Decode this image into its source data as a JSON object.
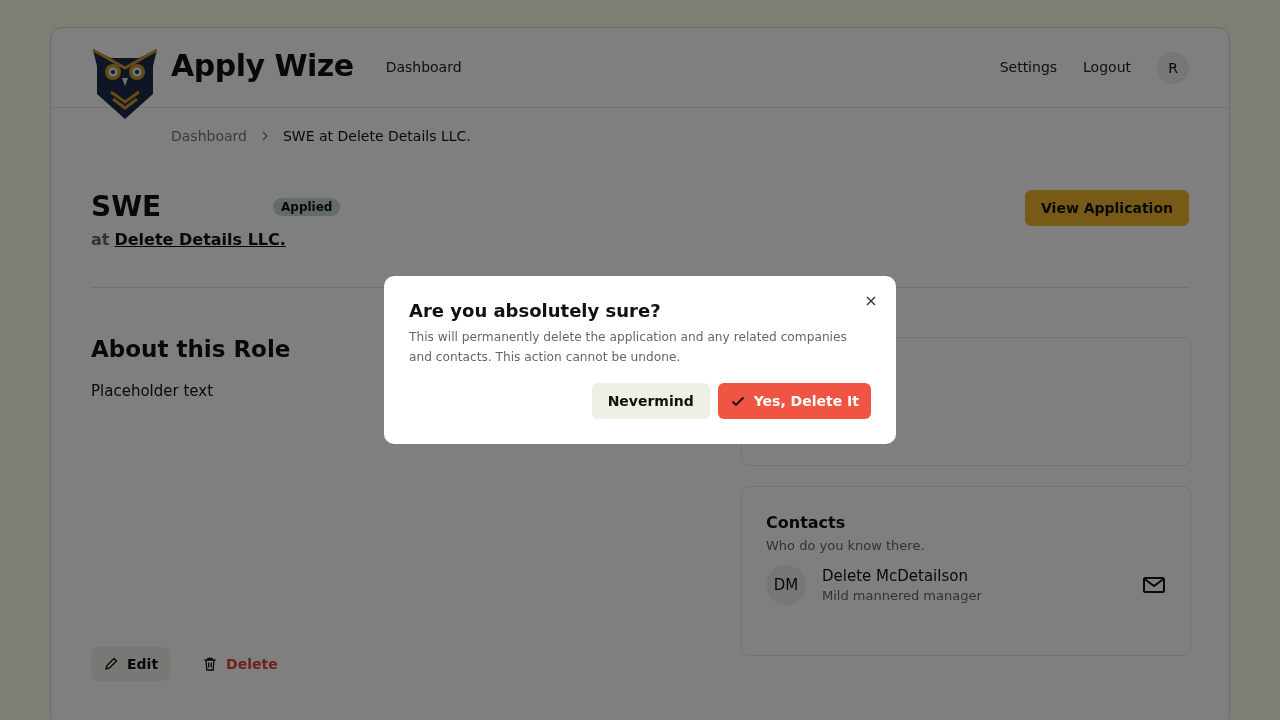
{
  "header": {
    "brand": "Apply Wize",
    "nav": [
      "Dashboard"
    ],
    "links": [
      "Settings",
      "Logout"
    ],
    "avatar": "R"
  },
  "breadcrumb": [
    {
      "label": "Dashboard",
      "current": false
    },
    {
      "label": "SWE at Delete Details LLC.",
      "current": true
    }
  ],
  "job": {
    "title": "SWE",
    "status": "Applied",
    "at": "at",
    "company": "Delete Details LLC.",
    "view_button": "View Application"
  },
  "about": {
    "heading": "About this Role",
    "text": "Placeholder text"
  },
  "contacts": {
    "heading": "Contacts",
    "subtitle": "Who do you know there.",
    "items": [
      {
        "initials": "DM",
        "name": "Delete McDetailson",
        "role": "Mild mannered manager"
      }
    ]
  },
  "actions": {
    "edit": "Edit",
    "delete": "Delete"
  },
  "dialog": {
    "title": "Are you absolutely sure?",
    "message": "This will permanently delete the application and any related companies and contacts. This action cannot be undone.",
    "cancel": "Nevermind",
    "confirm": "Yes, Delete It"
  }
}
